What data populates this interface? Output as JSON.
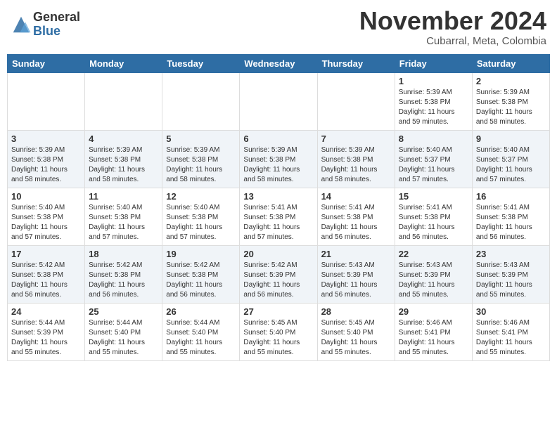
{
  "header": {
    "logo_general": "General",
    "logo_blue": "Blue",
    "month_title": "November 2024",
    "location": "Cubarral, Meta, Colombia"
  },
  "days_of_week": [
    "Sunday",
    "Monday",
    "Tuesday",
    "Wednesday",
    "Thursday",
    "Friday",
    "Saturday"
  ],
  "weeks": [
    [
      {
        "day": "",
        "info": ""
      },
      {
        "day": "",
        "info": ""
      },
      {
        "day": "",
        "info": ""
      },
      {
        "day": "",
        "info": ""
      },
      {
        "day": "",
        "info": ""
      },
      {
        "day": "1",
        "info": "Sunrise: 5:39 AM\nSunset: 5:38 PM\nDaylight: 11 hours\nand 59 minutes."
      },
      {
        "day": "2",
        "info": "Sunrise: 5:39 AM\nSunset: 5:38 PM\nDaylight: 11 hours\nand 58 minutes."
      }
    ],
    [
      {
        "day": "3",
        "info": "Sunrise: 5:39 AM\nSunset: 5:38 PM\nDaylight: 11 hours\nand 58 minutes."
      },
      {
        "day": "4",
        "info": "Sunrise: 5:39 AM\nSunset: 5:38 PM\nDaylight: 11 hours\nand 58 minutes."
      },
      {
        "day": "5",
        "info": "Sunrise: 5:39 AM\nSunset: 5:38 PM\nDaylight: 11 hours\nand 58 minutes."
      },
      {
        "day": "6",
        "info": "Sunrise: 5:39 AM\nSunset: 5:38 PM\nDaylight: 11 hours\nand 58 minutes."
      },
      {
        "day": "7",
        "info": "Sunrise: 5:39 AM\nSunset: 5:38 PM\nDaylight: 11 hours\nand 58 minutes."
      },
      {
        "day": "8",
        "info": "Sunrise: 5:40 AM\nSunset: 5:37 PM\nDaylight: 11 hours\nand 57 minutes."
      },
      {
        "day": "9",
        "info": "Sunrise: 5:40 AM\nSunset: 5:37 PM\nDaylight: 11 hours\nand 57 minutes."
      }
    ],
    [
      {
        "day": "10",
        "info": "Sunrise: 5:40 AM\nSunset: 5:38 PM\nDaylight: 11 hours\nand 57 minutes."
      },
      {
        "day": "11",
        "info": "Sunrise: 5:40 AM\nSunset: 5:38 PM\nDaylight: 11 hours\nand 57 minutes."
      },
      {
        "day": "12",
        "info": "Sunrise: 5:40 AM\nSunset: 5:38 PM\nDaylight: 11 hours\nand 57 minutes."
      },
      {
        "day": "13",
        "info": "Sunrise: 5:41 AM\nSunset: 5:38 PM\nDaylight: 11 hours\nand 57 minutes."
      },
      {
        "day": "14",
        "info": "Sunrise: 5:41 AM\nSunset: 5:38 PM\nDaylight: 11 hours\nand 56 minutes."
      },
      {
        "day": "15",
        "info": "Sunrise: 5:41 AM\nSunset: 5:38 PM\nDaylight: 11 hours\nand 56 minutes."
      },
      {
        "day": "16",
        "info": "Sunrise: 5:41 AM\nSunset: 5:38 PM\nDaylight: 11 hours\nand 56 minutes."
      }
    ],
    [
      {
        "day": "17",
        "info": "Sunrise: 5:42 AM\nSunset: 5:38 PM\nDaylight: 11 hours\nand 56 minutes."
      },
      {
        "day": "18",
        "info": "Sunrise: 5:42 AM\nSunset: 5:38 PM\nDaylight: 11 hours\nand 56 minutes."
      },
      {
        "day": "19",
        "info": "Sunrise: 5:42 AM\nSunset: 5:38 PM\nDaylight: 11 hours\nand 56 minutes."
      },
      {
        "day": "20",
        "info": "Sunrise: 5:42 AM\nSunset: 5:39 PM\nDaylight: 11 hours\nand 56 minutes."
      },
      {
        "day": "21",
        "info": "Sunrise: 5:43 AM\nSunset: 5:39 PM\nDaylight: 11 hours\nand 56 minutes."
      },
      {
        "day": "22",
        "info": "Sunrise: 5:43 AM\nSunset: 5:39 PM\nDaylight: 11 hours\nand 55 minutes."
      },
      {
        "day": "23",
        "info": "Sunrise: 5:43 AM\nSunset: 5:39 PM\nDaylight: 11 hours\nand 55 minutes."
      }
    ],
    [
      {
        "day": "24",
        "info": "Sunrise: 5:44 AM\nSunset: 5:39 PM\nDaylight: 11 hours\nand 55 minutes."
      },
      {
        "day": "25",
        "info": "Sunrise: 5:44 AM\nSunset: 5:40 PM\nDaylight: 11 hours\nand 55 minutes."
      },
      {
        "day": "26",
        "info": "Sunrise: 5:44 AM\nSunset: 5:40 PM\nDaylight: 11 hours\nand 55 minutes."
      },
      {
        "day": "27",
        "info": "Sunrise: 5:45 AM\nSunset: 5:40 PM\nDaylight: 11 hours\nand 55 minutes."
      },
      {
        "day": "28",
        "info": "Sunrise: 5:45 AM\nSunset: 5:40 PM\nDaylight: 11 hours\nand 55 minutes."
      },
      {
        "day": "29",
        "info": "Sunrise: 5:46 AM\nSunset: 5:41 PM\nDaylight: 11 hours\nand 55 minutes."
      },
      {
        "day": "30",
        "info": "Sunrise: 5:46 AM\nSunset: 5:41 PM\nDaylight: 11 hours\nand 55 minutes."
      }
    ]
  ]
}
